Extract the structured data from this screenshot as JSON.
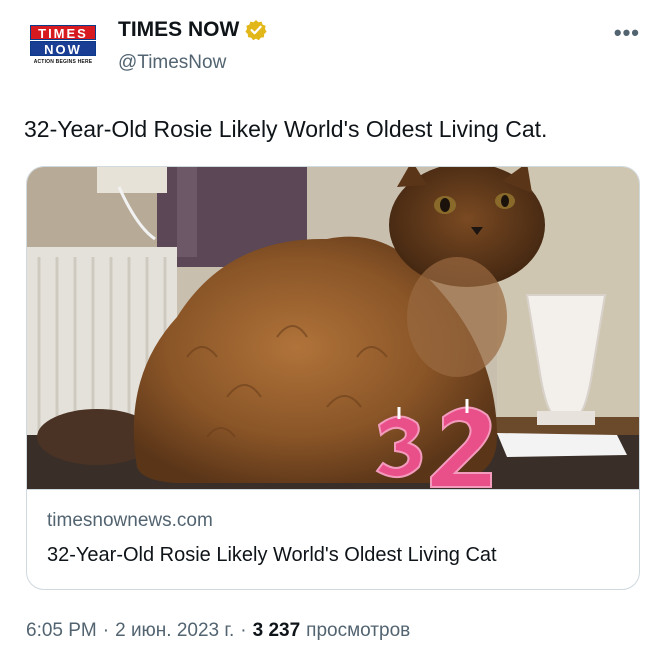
{
  "account": {
    "logo_line1": "TIMES",
    "logo_line2": "NOW",
    "logo_tagline": "ACTION BEGINS HERE",
    "display_name": "TIMES NOW",
    "handle": "@TimesNow",
    "verified_icon": "gold-verified-badge"
  },
  "more_label": "•••",
  "tweet": {
    "text": "32-Year-Old Rosie Likely World's Oldest Living Cat."
  },
  "card": {
    "image_icon": "cat-photo",
    "candle_text": "32",
    "domain": "timesnownews.com",
    "title": "32-Year-Old Rosie Likely World's Oldest Living Cat"
  },
  "meta": {
    "time": "6:05 PM",
    "separator": "·",
    "date": "2 июн. 2023 г.",
    "views_count": "3 237",
    "views_label": "просмотров"
  },
  "colors": {
    "text": "#0f1419",
    "muted": "#536471",
    "border": "#cfd9de",
    "brand_red": "#d71920",
    "brand_blue": "#1a3e93",
    "verified_gold": "#e2b719"
  }
}
